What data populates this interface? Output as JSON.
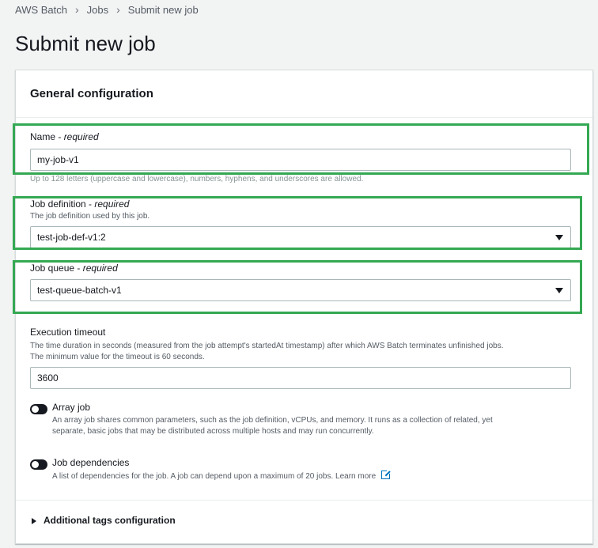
{
  "breadcrumb": {
    "items": [
      "AWS Batch",
      "Jobs",
      "Submit new job"
    ]
  },
  "page_title": "Submit new job",
  "panel": {
    "title": "General configuration",
    "name_field": {
      "label": "Name - ",
      "required": "required",
      "value": "my-job-v1",
      "hint": "Up to 128 letters (uppercase and lowercase), numbers, hyphens, and underscores are allowed."
    },
    "job_definition": {
      "label": "Job definition - ",
      "required": "required",
      "description": "The job definition used by this job.",
      "value": "test-job-def-v1:2"
    },
    "job_queue": {
      "label": "Job queue - ",
      "required": "required",
      "value": "test-queue-batch-v1"
    },
    "execution_timeout": {
      "label": "Execution timeout",
      "description_1": "The time duration in seconds (measured from the job attempt's startedAt timestamp) after which AWS Batch terminates unfinished jobs.",
      "description_2": "The minimum value for the timeout is 60 seconds.",
      "value": "3600"
    },
    "array_job": {
      "label": "Array job",
      "description_1": "An array job shares common parameters, such as the job definition, vCPUs, and memory. It runs as a collection of related, yet",
      "description_2": "separate, basic jobs that may be distributed across multiple hosts and may run concurrently.",
      "enabled": false
    },
    "job_dependencies": {
      "label": "Job dependencies",
      "description": "A list of dependencies for the job. A job can depend upon a maximum of 20 jobs.",
      "learn_more": "Learn more",
      "enabled": false
    },
    "additional_tags": {
      "label": "Additional tags configuration"
    }
  },
  "colors": {
    "highlight": "#34a853",
    "text": "#16191f",
    "muted": "#545b64"
  }
}
